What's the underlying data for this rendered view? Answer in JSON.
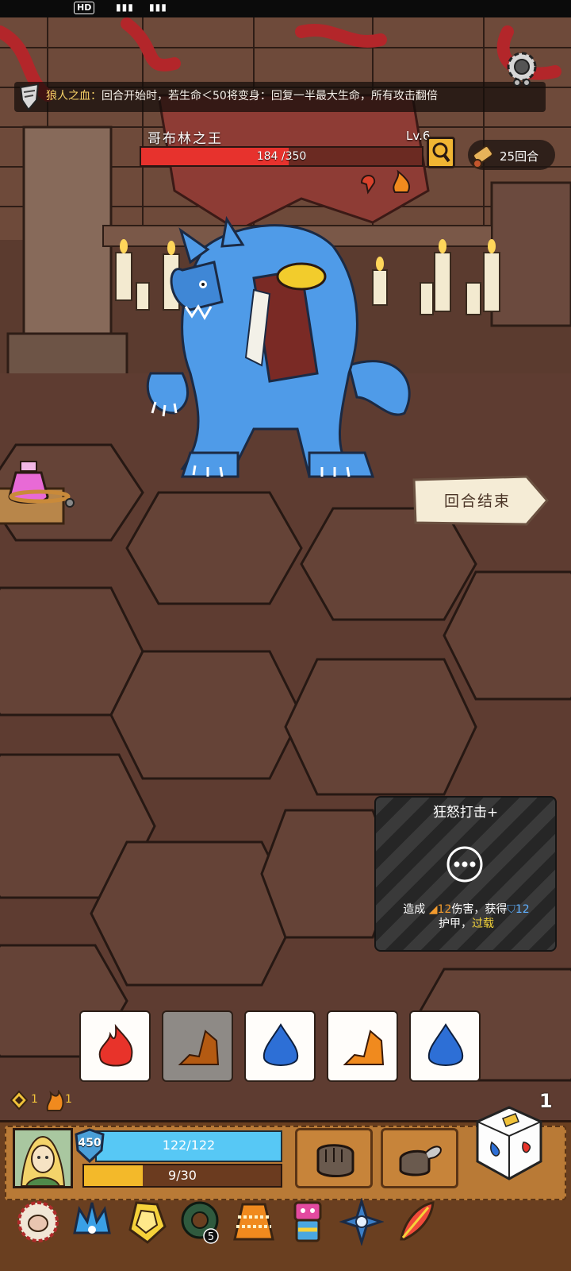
{
  "hint": {
    "label": "狼人之血：",
    "text": "回合开始时，若生命＜50将变身：回复一半最大生命，所有攻击翻倍"
  },
  "boss": {
    "name": "哥布林之王",
    "level": "Lv.6",
    "hp_text": "184 /350",
    "hp_fraction": 0.526
  },
  "turn": {
    "text": "25回合"
  },
  "end_turn": {
    "label": "回合结束"
  },
  "skill": {
    "title": "狂怒打击+",
    "desc_prefix": "造成",
    "damage": "12",
    "desc_mid": "伤害，获得",
    "armor": "12",
    "desc_line2_a": "护甲，",
    "desc_line2_b": "过载"
  },
  "dice": [
    {
      "type": "fire",
      "color": "#e8332a",
      "used": false
    },
    {
      "type": "earth",
      "color": "#b45a12",
      "used": true
    },
    {
      "type": "water",
      "color": "#2d6fd6",
      "used": false
    },
    {
      "type": "earth",
      "color": "#f08a1e",
      "used": false
    },
    {
      "type": "water",
      "color": "#2d6fd6",
      "used": false
    }
  ],
  "resources": {
    "gold": "1",
    "flame": "1"
  },
  "reroll_count": "1",
  "player": {
    "shield": "450",
    "hp_text": "122/122",
    "hp_fraction": 1.0,
    "energy_text": "9/30",
    "energy_fraction": 0.3
  },
  "items": [
    "fist-icon",
    "charging-fist-icon"
  ],
  "relics": [
    "sun-mask-icon",
    "ice-crown-icon",
    "amber-gem-icon",
    "snake-ring-icon",
    "woven-cloak-icon",
    "totem-icon",
    "compass-star-icon",
    "phoenix-feather-icon"
  ],
  "relic_badge": "5",
  "colors": {
    "hp_red": "#e7322d",
    "player_hp": "#57c8f5",
    "energy": "#f3b92a"
  }
}
